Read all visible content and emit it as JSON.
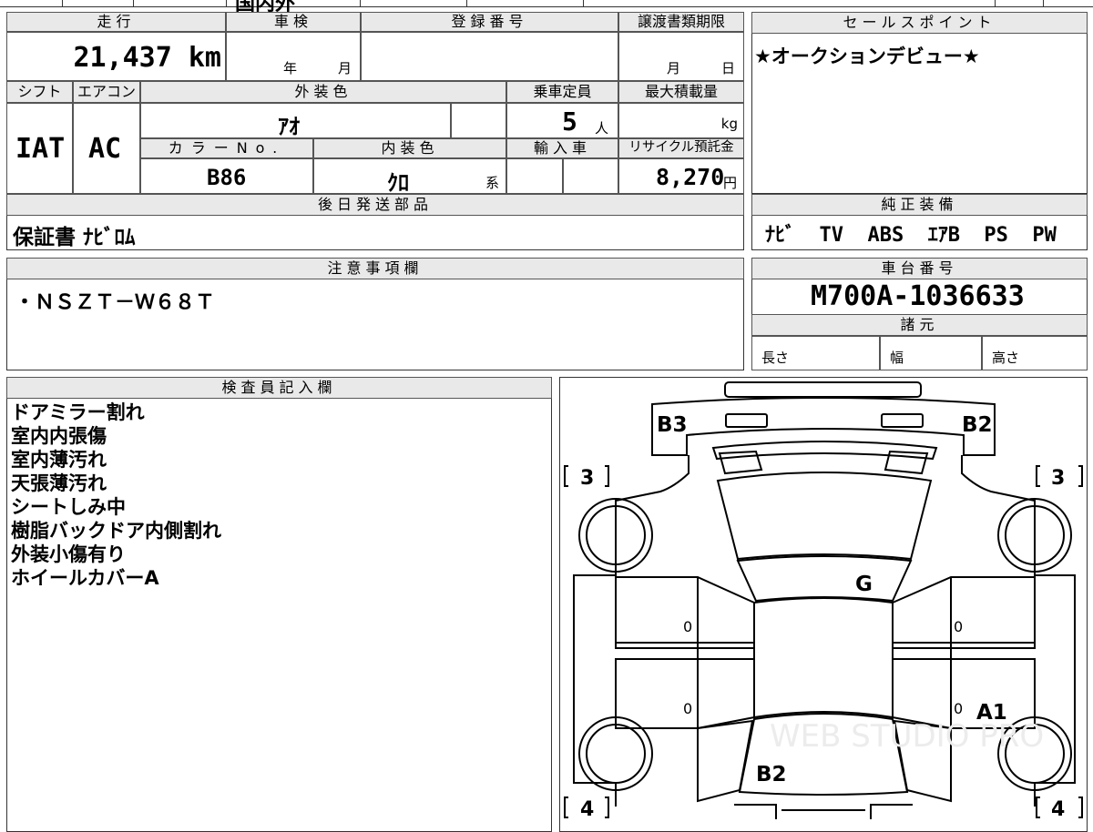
{
  "top_strip": {
    "partial_text": "国内外"
  },
  "mileage": {
    "header": "走行",
    "value": "21,437 km"
  },
  "inspection": {
    "header": "車検",
    "year_unit": "年",
    "month_unit": "月"
  },
  "registration": {
    "header": "登録番号",
    "value": ""
  },
  "transfer_deadline": {
    "header": "譲渡書類期限",
    "month_unit": "月",
    "day_unit": "日"
  },
  "shift": {
    "header": "シフト",
    "value": "IAT"
  },
  "aircon": {
    "header": "エアコン",
    "value": "AC"
  },
  "exterior_color": {
    "header": "外装色",
    "value": "ｱｵ"
  },
  "capacity": {
    "header": "乗車定員",
    "value": "5",
    "unit": "人"
  },
  "max_load": {
    "header": "最大積載量",
    "unit": "kg"
  },
  "color_no": {
    "header": "カラーNo.",
    "value": "B86"
  },
  "interior_color": {
    "header": "内装色",
    "value": "ｸﾛ",
    "suffix": "系"
  },
  "import_car": {
    "header": "輸入車"
  },
  "recycle_fee": {
    "header": "リサイクル預託金",
    "value": "8,270",
    "unit": "円"
  },
  "sales_point": {
    "header": "セールスポイント",
    "text": "★オークションデビュー★"
  },
  "later_parts": {
    "header": "後日発送部品",
    "text": "保証書 ﾅﾋﾞﾛﾑ"
  },
  "genuine_equipment": {
    "header": "純正装備",
    "text": "ﾅﾋﾞ  TV  ABS  ｴｱB  PS  PW"
  },
  "notes": {
    "header": "注意事項欄",
    "text": "・ＮＳＺＴ－Ｗ６８Ｔ"
  },
  "chassis": {
    "header": "車台番号",
    "value": "M700A-1036633"
  },
  "specs": {
    "header": "諸元",
    "length": "長さ",
    "width": "幅",
    "height": "高さ"
  },
  "inspector": {
    "header": "検査員記入欄",
    "lines": [
      "ドアミラー割れ",
      "室内内張傷",
      "室内薄汚れ",
      "天張薄汚れ",
      "シートしみ中",
      "樹脂バックドア内側割れ",
      "外装小傷有り",
      "ホイールカバーA"
    ]
  },
  "diagram": {
    "marks": {
      "rear_left": "B3",
      "rear_right": "B2",
      "glass": "G",
      "right_rear_door": "A1",
      "front_center": "B2"
    },
    "zeros": [
      "0",
      "0",
      "0",
      "0"
    ],
    "grades": {
      "top_left": "3",
      "top_right": "3",
      "bottom_left": "4",
      "bottom_right": "4"
    },
    "watermark": "WEB STUDIO PRO"
  }
}
